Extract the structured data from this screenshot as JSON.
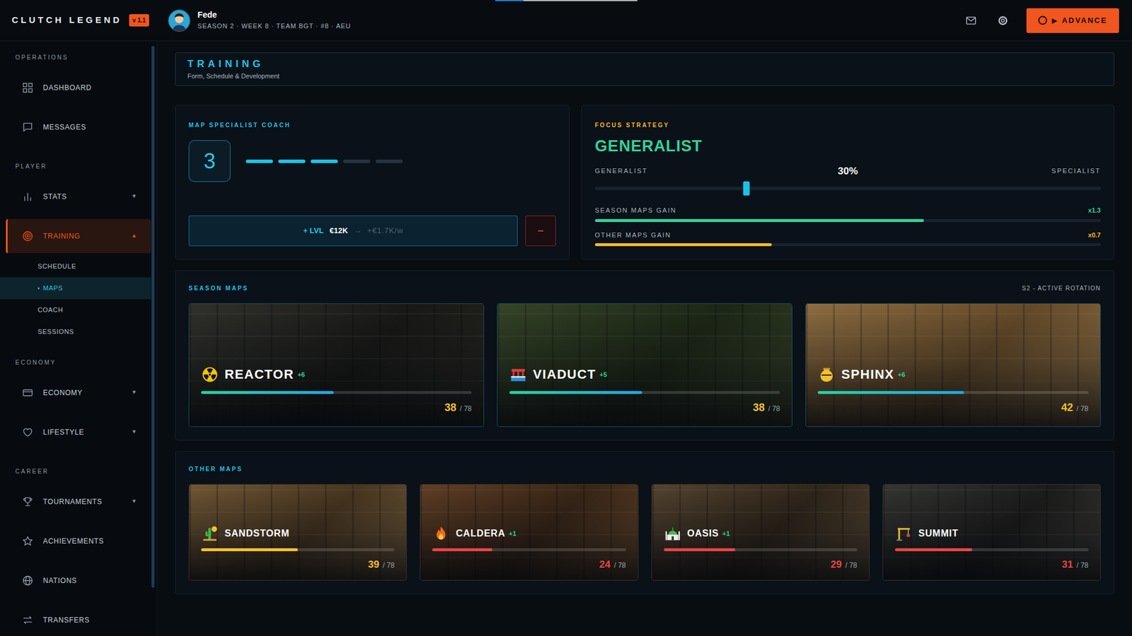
{
  "app": {
    "title": "CLUTCH LEGEND",
    "version": "v 1.1"
  },
  "top_progress": {
    "level": 0.2
  },
  "user": {
    "name": "Fede",
    "subtitle": "SEASON 2 · WEEK 8 · TEAM BGT · #8 · AEU"
  },
  "advance_button": {
    "icon": "▶",
    "label": "ADVANCE"
  },
  "sidebar": {
    "sections": [
      {
        "title": "OPERATIONS",
        "items": [
          {
            "label": "DASHBOARD",
            "selected": false
          },
          {
            "label": "MESSAGES",
            "selected": false
          }
        ]
      },
      {
        "title": "PLAYER",
        "items": [
          {
            "label": "STATS",
            "selected": false,
            "arrow": "▼",
            "expanded": false
          },
          {
            "label": "TRAINING",
            "selected": true,
            "arrow": "▲",
            "expanded": true,
            "children": [
              {
                "label": "SCHEDULE",
                "selected": false
              },
              {
                "label": "MAPS",
                "selected": true
              },
              {
                "label": "COACH",
                "selected": false
              },
              {
                "label": "SESSIONS",
                "selected": false
              }
            ]
          }
        ]
      },
      {
        "title": "ECONOMY",
        "items": [
          {
            "label": "ECONOMY",
            "selected": false,
            "arrow": "▼",
            "expanded": false
          },
          {
            "label": "LIFESTYLE",
            "selected": false,
            "arrow": "▼",
            "expanded": false
          }
        ]
      },
      {
        "title": "CAREER",
        "items": [
          {
            "label": "TOURNAMENTS",
            "selected": false,
            "arrow": "▼",
            "expanded": false
          },
          {
            "label": "ACHIEVEMENTS",
            "selected": false
          },
          {
            "label": "NATIONS",
            "selected": false
          },
          {
            "label": "TRANSFERS",
            "selected": false
          }
        ]
      }
    ]
  },
  "page_header": {
    "title": "TRAINING",
    "subtitle": "Form, Schedule & Development"
  },
  "coach": {
    "title": "MAP SPECIALIST COACH",
    "level": "3",
    "pips": [
      {
        "filled": true
      },
      {
        "filled": true
      },
      {
        "filled": true
      },
      {
        "filled": false
      },
      {
        "filled": false
      }
    ],
    "upgrade": {
      "prefix": "+ LVL",
      "cost": "€12K",
      "arrow": "→",
      "effect": "+€1.7K/w"
    },
    "downgrade": "−"
  },
  "focus": {
    "title": "FOCUS STRATEGY",
    "value": "GENERALIST",
    "left_label": "GENERALIST",
    "right_label": "SPECIALIST",
    "percent": "30%",
    "level": 0.3,
    "gains": [
      {
        "label": "SEASON MAPS GAIN",
        "value": "x1.3",
        "level": 0.65,
        "color": "#2fd39a"
      },
      {
        "label": "OTHER MAPS GAIN",
        "value": "x0.7",
        "level": 0.35,
        "color": "#f5b82e"
      }
    ]
  },
  "season_maps": {
    "title": "SEASON MAPS",
    "tag": "S2 - ACTIVE ROTATION",
    "maps": [
      {
        "name": "REACTOR",
        "delta": "+6",
        "value": "38",
        "max": "/ 78",
        "level": 0.49,
        "color": "#f5c02e"
      },
      {
        "name": "VIADUCT",
        "delta": "+5",
        "value": "38",
        "max": "/ 78",
        "level": 0.49,
        "color": "#f5c02e"
      },
      {
        "name": "SPHINX",
        "delta": "+6",
        "value": "42",
        "max": "/ 78",
        "level": 0.54,
        "color": "#f5c02e"
      }
    ]
  },
  "other_maps": {
    "title": "OTHER MAPS",
    "maps": [
      {
        "name": "SANDSTORM",
        "value": "39",
        "max": "/ 78",
        "level": 0.5,
        "color": "#f5c02e"
      },
      {
        "name": "CALDERA",
        "delta": "+1",
        "value": "24",
        "max": "/ 78",
        "level": 0.31,
        "color": "#e84545"
      },
      {
        "name": "OASIS",
        "delta": "+1",
        "value": "29",
        "max": "/ 78",
        "level": 0.37,
        "color": "#e84545"
      },
      {
        "name": "SUMMIT",
        "value": "31",
        "max": "/ 78",
        "level": 0.4,
        "color": "#e84545"
      }
    ]
  }
}
